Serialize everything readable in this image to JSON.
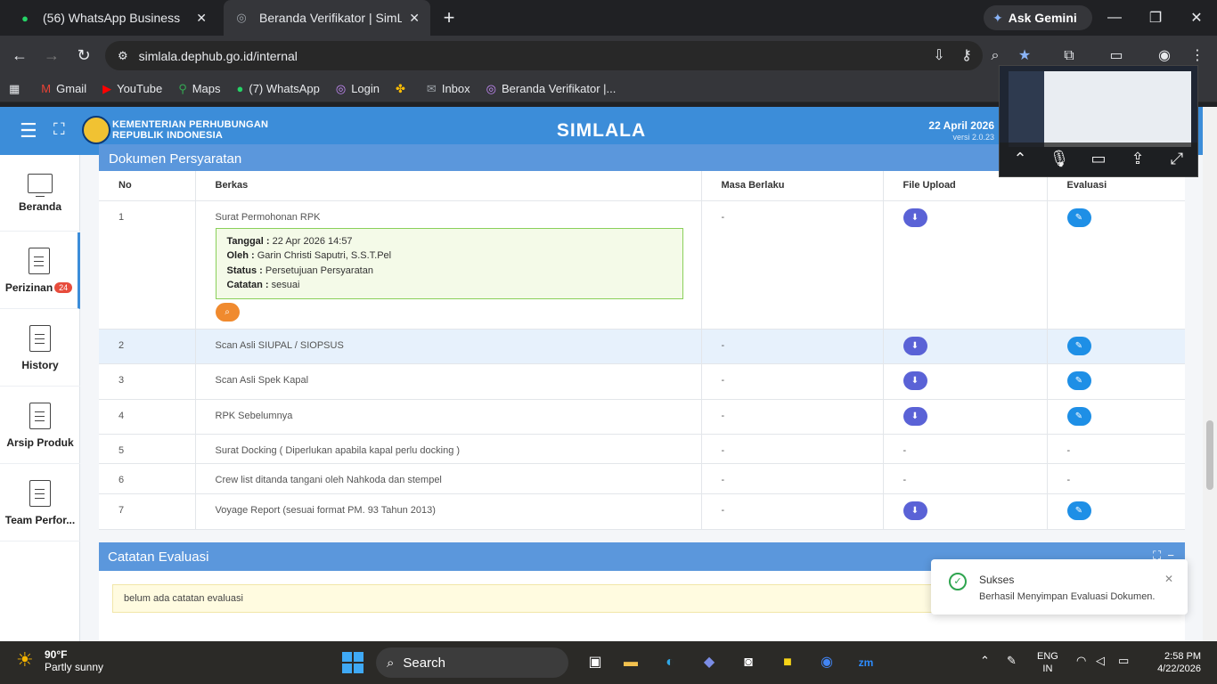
{
  "browser": {
    "tabs": [
      {
        "title": "(56) WhatsApp Business",
        "icon": "whatsapp-icon"
      },
      {
        "title": "Beranda Verifikator | SimLala",
        "icon": "globe-icon"
      }
    ],
    "gemini_label": "Ask Gemini",
    "url": "simlala.dephub.go.id/internal",
    "bookmarks": [
      {
        "label": "Gmail",
        "icon": "gmail-icon"
      },
      {
        "label": "YouTube",
        "icon": "youtube-icon"
      },
      {
        "label": "Maps",
        "icon": "maps-icon"
      },
      {
        "label": "(7) WhatsApp",
        "icon": "whatsapp-icon"
      },
      {
        "label": "Login",
        "icon": "globe-icon"
      },
      {
        "label": "",
        "icon": "pinwheel-icon"
      },
      {
        "label": "Inbox",
        "icon": "mail-icon"
      },
      {
        "label": "Beranda Verifikator |...",
        "icon": "globe-icon"
      }
    ]
  },
  "header": {
    "org_line1": "KEMENTERIAN PERHUBUNGAN",
    "org_line2": "REPUBLIK INDONESIA",
    "app_name": "SIMLALA",
    "date": "22 April 2026",
    "version": "versi 2.0.23"
  },
  "sidebar": {
    "items": [
      {
        "label": "Beranda",
        "badge": ""
      },
      {
        "label": "Perizinan",
        "badge": "24"
      },
      {
        "label": "History",
        "badge": ""
      },
      {
        "label": "Arsip Produk",
        "badge": ""
      },
      {
        "label": "Team Perfor...",
        "badge": ""
      }
    ]
  },
  "documents": {
    "title": "Dokumen Persyaratan",
    "columns": [
      "No",
      "Berkas",
      "Masa Berlaku",
      "File Upload",
      "Evaluasi"
    ],
    "rows": [
      {
        "no": "1",
        "berkas": "Surat Permohonan RPK",
        "masa": "-",
        "file": "download",
        "eval": "edit"
      },
      {
        "no": "2",
        "berkas": "Scan Asli SIUPAL / SIOPSUS",
        "masa": "-",
        "file": "download",
        "eval": "edit"
      },
      {
        "no": "3",
        "berkas": "Scan Asli Spek Kapal",
        "masa": "-",
        "file": "download",
        "eval": "edit"
      },
      {
        "no": "4",
        "berkas": "RPK Sebelumnya",
        "masa": "-",
        "file": "download",
        "eval": "edit"
      },
      {
        "no": "5",
        "berkas": "Surat Docking ( Diperlukan apabila kapal perlu docking )",
        "masa": "-",
        "file": "-",
        "eval": "-"
      },
      {
        "no": "6",
        "berkas": "Crew list ditanda tangani oleh Nahkoda dan stempel",
        "masa": "-",
        "file": "-",
        "eval": "-"
      },
      {
        "no": "7",
        "berkas": "Voyage Report (sesuai format PM. 93 Tahun 2013)",
        "masa": "-",
        "file": "download",
        "eval": "edit"
      }
    ],
    "detail": {
      "tanggal_label": "Tanggal :",
      "tanggal": "22 Apr 2026 14:57",
      "oleh_label": "Oleh :",
      "oleh": "Garin Christi Saputri, S.S.T.Pel",
      "status_label": "Status :",
      "status": "Persetujuan Persyaratan",
      "catatan_label": "Catatan :",
      "catatan": "sesuai"
    }
  },
  "evaluation_notes": {
    "title": "Catatan Evaluasi",
    "empty_text": "belum ada catatan evaluasi"
  },
  "toast": {
    "title": "Sukses",
    "message": "Berhasil Menyimpan Evaluasi Dokumen."
  },
  "taskbar": {
    "temperature": "90°F",
    "weather": "Partly sunny",
    "search_placeholder": "Search",
    "lang_line1": "ENG",
    "lang_line2": "IN",
    "time": "2:58 PM",
    "date": "4/22/2026"
  },
  "colors": {
    "header_blue": "#3c8dd9",
    "download_button": "#5a62d6",
    "edit_button": "#1e8fe6",
    "success_green": "#2ea44f"
  }
}
